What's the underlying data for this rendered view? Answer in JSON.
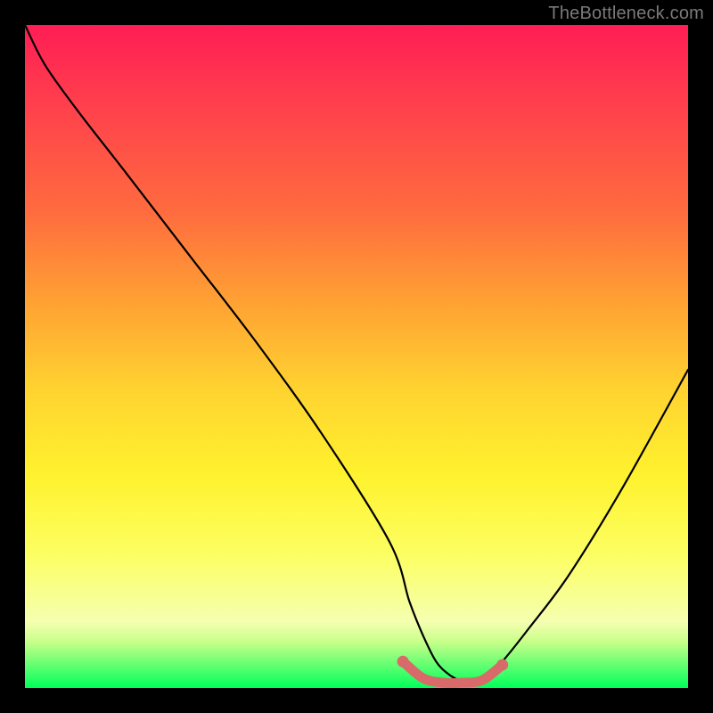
{
  "watermark": "TheBottleneck.com",
  "chart_data": {
    "type": "line",
    "title": "",
    "xlabel": "",
    "ylabel": "",
    "xlim": [
      0,
      100
    ],
    "ylim": [
      0,
      100
    ],
    "series": [
      {
        "name": "bottleneck-curve",
        "x": [
          0,
          3,
          8,
          15,
          25,
          35,
          45,
          55,
          58,
          60,
          62,
          64,
          66,
          68,
          70,
          72,
          76,
          82,
          90,
          100
        ],
        "values": [
          100,
          94,
          87,
          78,
          65,
          52,
          38,
          22,
          13,
          8,
          4,
          2,
          1,
          1,
          2,
          4,
          9,
          17,
          30,
          48
        ]
      }
    ],
    "highlight_region": {
      "name": "optimal-range",
      "x": [
        57,
        60,
        63,
        66,
        69,
        72
      ],
      "values": [
        4,
        1.5,
        0.8,
        0.8,
        1.2,
        3.5
      ]
    },
    "background_gradient": {
      "stops": [
        {
          "pos": 0,
          "color": "#ff1d55"
        },
        {
          "pos": 10,
          "color": "#ff3a4e"
        },
        {
          "pos": 28,
          "color": "#ff6b3f"
        },
        {
          "pos": 42,
          "color": "#ffa233"
        },
        {
          "pos": 55,
          "color": "#ffd330"
        },
        {
          "pos": 68,
          "color": "#fff22e"
        },
        {
          "pos": 80,
          "color": "#fcff63"
        },
        {
          "pos": 90,
          "color": "#f5ffb0"
        },
        {
          "pos": 93,
          "color": "#c8ff8a"
        },
        {
          "pos": 100,
          "color": "#00ff5a"
        }
      ]
    },
    "colors": {
      "curve": "#000000",
      "highlight": "#d86a6a",
      "frame": "#000000"
    }
  }
}
